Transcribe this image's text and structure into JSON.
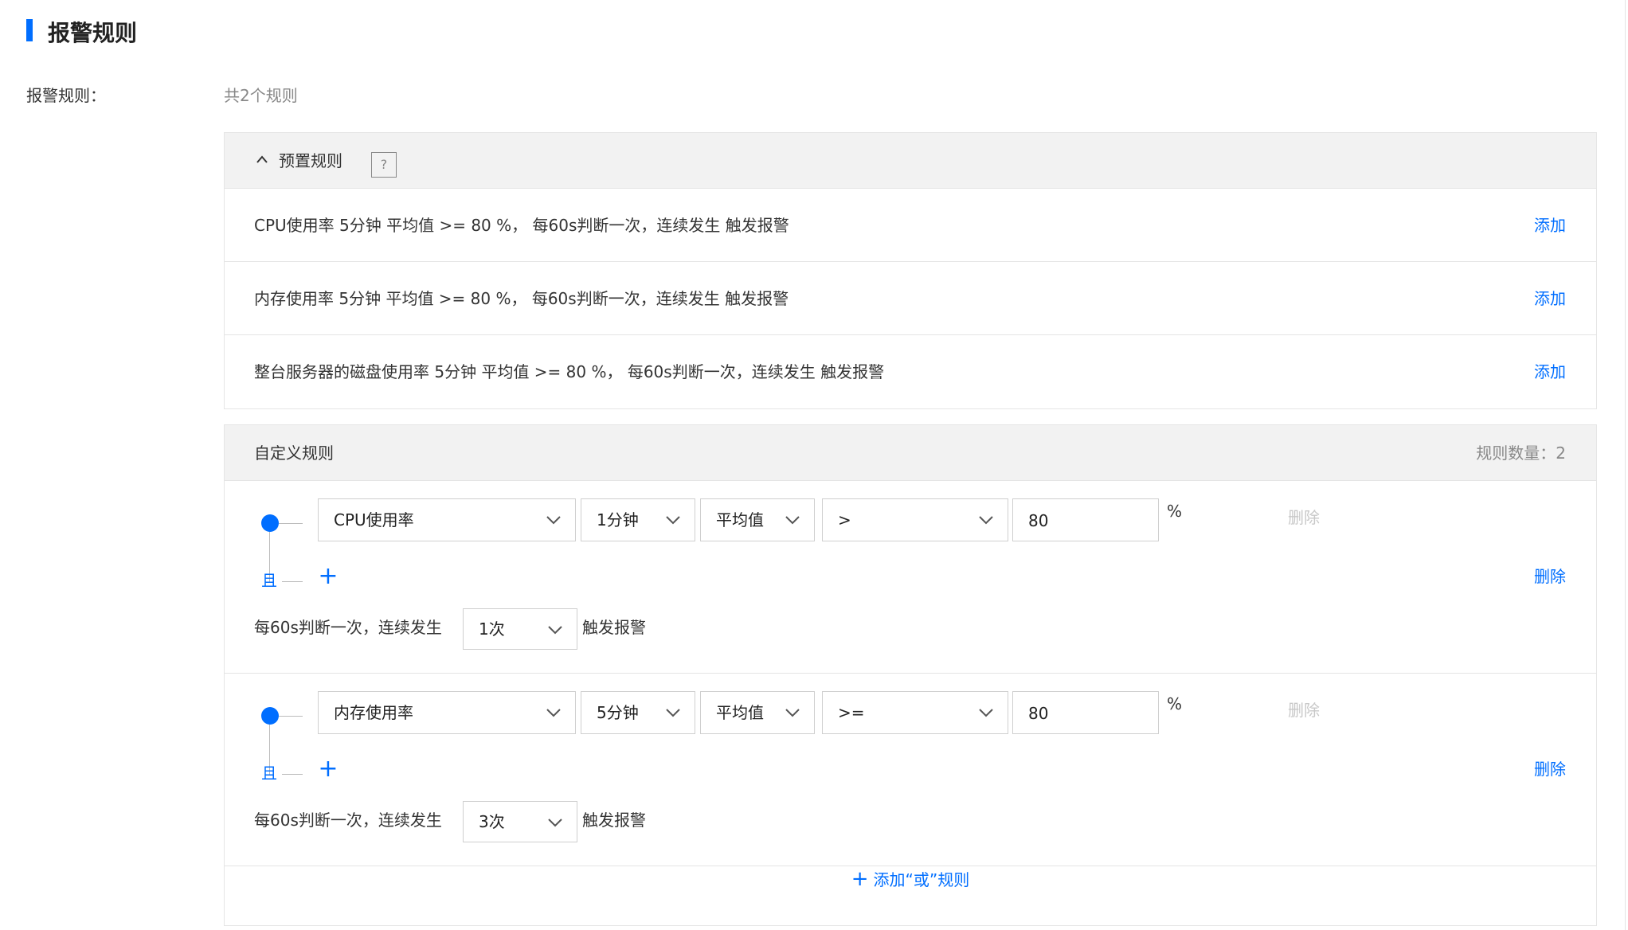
{
  "page": {
    "title": "报警规则"
  },
  "field": {
    "label": "报警规则：",
    "summary": "共2个规则"
  },
  "preset": {
    "title": "预置规则",
    "help": "?",
    "rows": [
      {
        "text": "CPU使用率 5分钟 平均值 >= 80 %， 每60s判断一次，连续发生 触发报警",
        "action": "添加"
      },
      {
        "text": "内存使用率 5分钟 平均值 >= 80 %， 每60s判断一次，连续发生 触发报警",
        "action": "添加"
      },
      {
        "text": "整台服务器的磁盘使用率 5分钟 平均值 >= 80 %， 每60s判断一次，连续发生 触发报警",
        "action": "添加"
      }
    ]
  },
  "custom": {
    "title": "自定义规则",
    "count_label": "规则数量：2",
    "rules": [
      {
        "metric": "CPU使用率",
        "period": "1分钟",
        "stat": "平均值",
        "operator": ">",
        "threshold": "80",
        "unit": "%",
        "delete_condition": "删除",
        "and_label": "且",
        "add_condition": "+",
        "delete_rule": "删除",
        "freq_prefix": "每60s判断一次，连续发生",
        "times": "1次",
        "freq_suffix": "触发报警"
      },
      {
        "metric": "内存使用率",
        "period": "5分钟",
        "stat": "平均值",
        "operator": ">=",
        "threshold": "80",
        "unit": "%",
        "delete_condition": "删除",
        "and_label": "且",
        "add_condition": "+",
        "delete_rule": "删除",
        "freq_prefix": "每60s判断一次，连续发生",
        "times": "3次",
        "freq_suffix": "触发报警"
      }
    ],
    "add_or": {
      "plus": "+",
      "label": "添加“或”规则"
    }
  },
  "colors": {
    "accent": "#006eff",
    "disabled": "#c8c8c8",
    "border": "#e5e5e5",
    "header_bg": "#f2f2f2"
  },
  "icons": {
    "collapse": "chevron-up-icon",
    "dropdown": "chevron-down-icon",
    "help": "question-icon",
    "add": "plus-icon"
  }
}
